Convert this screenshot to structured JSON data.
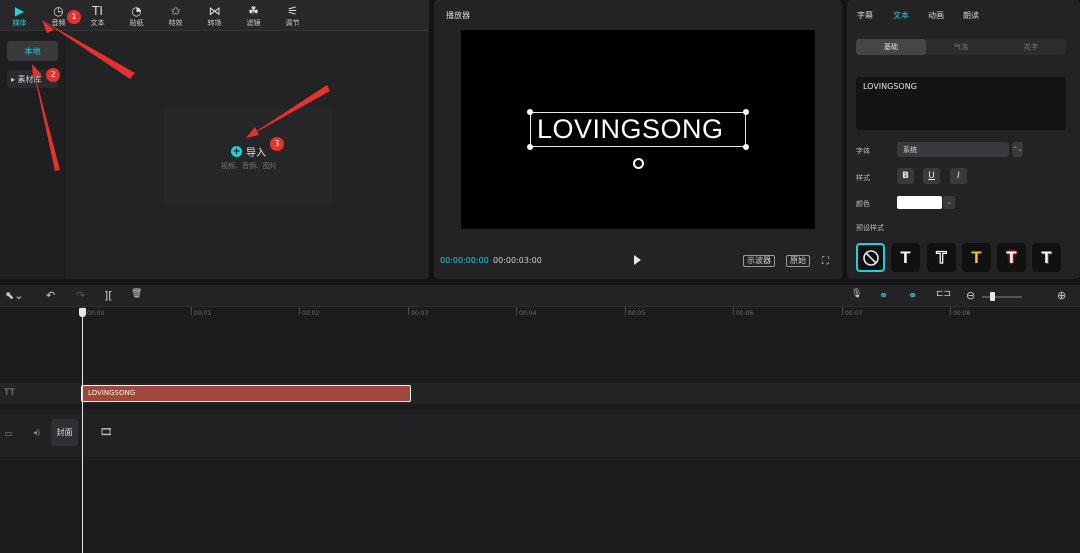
{
  "media": {
    "tabs": [
      {
        "label": "媒体",
        "icon": "media-play-icon"
      },
      {
        "label": "音频",
        "icon": "audio-disc-icon"
      },
      {
        "label": "文本",
        "icon": "text-icon"
      },
      {
        "label": "贴纸",
        "icon": "sticker-icon"
      },
      {
        "label": "特效",
        "icon": "effects-star-icon"
      },
      {
        "label": "转场",
        "icon": "transition-icon"
      },
      {
        "label": "滤镜",
        "icon": "filter-icon"
      },
      {
        "label": "调节",
        "icon": "adjust-sliders-icon"
      }
    ],
    "tab_icons": [
      "▶",
      "◷",
      "TI",
      "◔",
      "✩",
      "⋈",
      "☘",
      "⚟"
    ],
    "sidebar_local": "本地",
    "sidebar_library": "▸ 素材库",
    "import_label": "导入",
    "import_plus": "+",
    "import_hint": "视频、音频、图片"
  },
  "player": {
    "title": "播放器",
    "caption": "LOVINGSONG",
    "time_current": "00:00:00:00",
    "time_total": "00:00:03:00",
    "chip_waveform": "示波器",
    "chip_ratio": "原始",
    "fullscreen_icon": "⛶"
  },
  "props": {
    "tabs": [
      "字幕",
      "文本",
      "动画",
      "朗读"
    ],
    "subtabs": [
      "基础",
      "气泡",
      "花字"
    ],
    "text_value": "LOVINGSONG",
    "font_label": "字体",
    "font_value": "系统",
    "font_arrow": "⌃⌄",
    "style_label": "样式",
    "style_bold": "B",
    "style_underline": "U",
    "style_italic": "I",
    "color_label": "颜色",
    "color_value": "#ffffff",
    "color_arrow": "⌄",
    "preset_label": "预设样式",
    "preset_none": "⃠",
    "presets": [
      "T",
      "T",
      "T",
      "T",
      "T"
    ]
  },
  "timeline": {
    "tools": [
      "⬉⌄",
      "↶",
      "↷",
      "][",
      "🗑"
    ],
    "right_tools": [
      "🎙",
      "⚭",
      "⚭",
      "⊏⊐",
      "⊖",
      "⊕"
    ],
    "ticks": [
      "00:00",
      "00:01",
      "00:02",
      "00:03",
      "00:04",
      "00:05",
      "00:06",
      "00:07",
      "00:08"
    ],
    "text_track_icon": "TT",
    "text_clip": "LOVINGSONG",
    "main_track_icon": "▭",
    "audio_icon": "◂)",
    "cover_label": "封面",
    "film_icon": "🎞"
  },
  "annotations": {
    "badges": [
      "1",
      "2",
      "3"
    ],
    "color": "#e5322d"
  }
}
